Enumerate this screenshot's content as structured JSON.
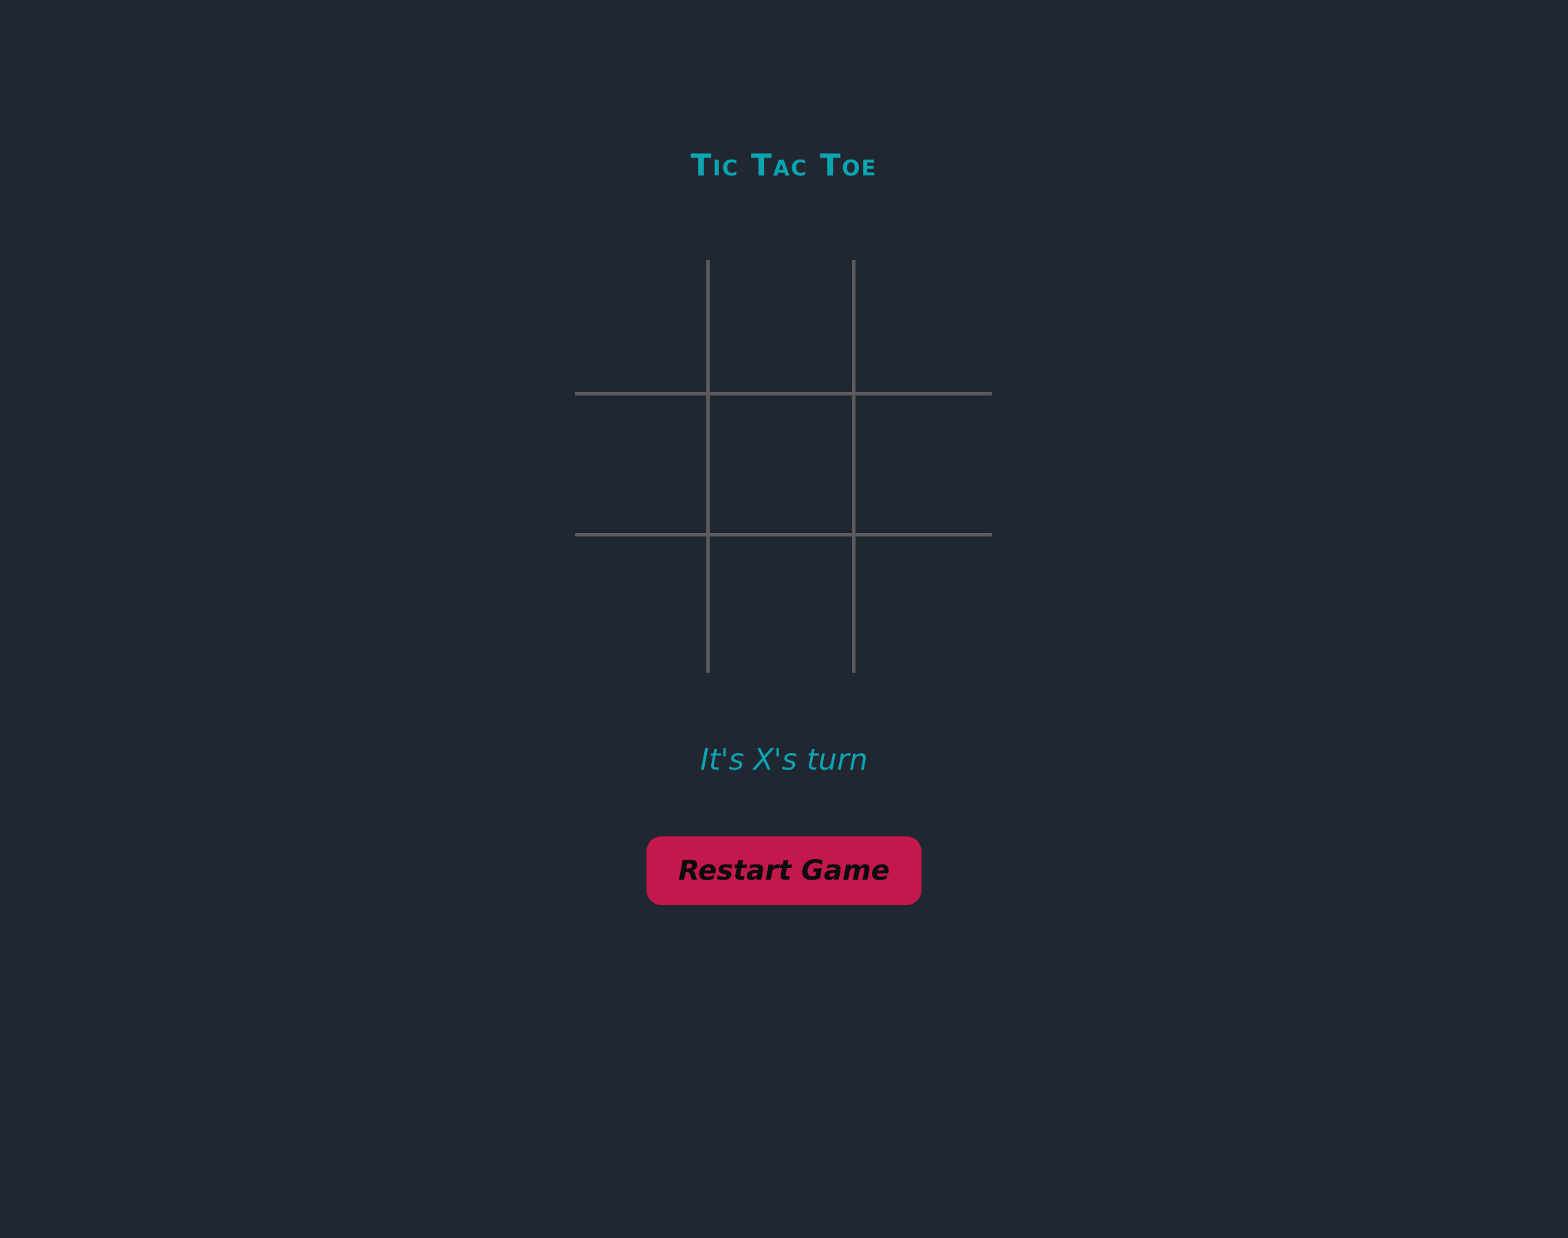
{
  "game": {
    "title": "Tic Tac Toe",
    "status": "It's X's turn",
    "restart_label": "Restart Game",
    "board": [
      "",
      "",
      "",
      "",
      "",
      "",
      "",
      "",
      ""
    ]
  },
  "colors": {
    "background": "#212731",
    "accent": "#0aa5b2",
    "grid_line": "#5d5a5f",
    "button": "#c2184b",
    "button_text": "#0b0b0e"
  }
}
